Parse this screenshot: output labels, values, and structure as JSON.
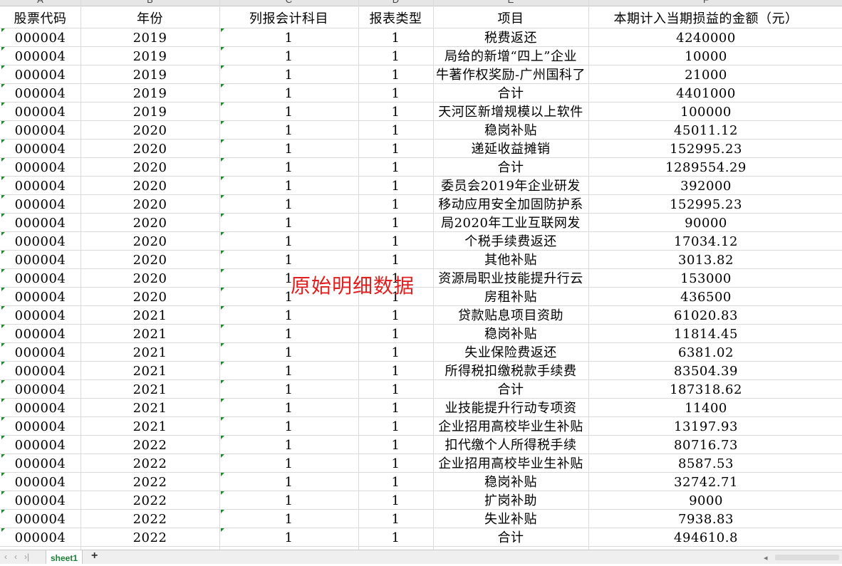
{
  "column_letters": [
    "A",
    "B",
    "C",
    "D",
    "E",
    "F"
  ],
  "headers": [
    "股票代码",
    "年份",
    "列报会计科目",
    "报表类型",
    "项目",
    "本期计入当期损益的金额（元）"
  ],
  "rows": [
    [
      "000004",
      "2019",
      "1",
      "1",
      "税费返还",
      "4240000"
    ],
    [
      "000004",
      "2019",
      "1",
      "1",
      "局给的新增“四上”企业",
      "10000"
    ],
    [
      "000004",
      "2019",
      "1",
      "1",
      "牛著作权奖励-广州国科了",
      "21000"
    ],
    [
      "000004",
      "2019",
      "1",
      "1",
      "合计",
      "4401000"
    ],
    [
      "000004",
      "2019",
      "1",
      "1",
      "天河区新增规模以上软件",
      "100000"
    ],
    [
      "000004",
      "2020",
      "1",
      "1",
      "稳岗补贴",
      "45011.12"
    ],
    [
      "000004",
      "2020",
      "1",
      "1",
      "递延收益摊销",
      "152995.23"
    ],
    [
      "000004",
      "2020",
      "1",
      "1",
      "合计",
      "1289554.29"
    ],
    [
      "000004",
      "2020",
      "1",
      "1",
      "委员会2019年企业研发",
      "392000"
    ],
    [
      "000004",
      "2020",
      "1",
      "1",
      "移动应用安全加固防护系",
      "152995.23"
    ],
    [
      "000004",
      "2020",
      "1",
      "1",
      "局2020年工业互联网发",
      "90000"
    ],
    [
      "000004",
      "2020",
      "1",
      "1",
      "个税手续费返还",
      "17034.12"
    ],
    [
      "000004",
      "2020",
      "1",
      "1",
      "其他补贴",
      "3013.82"
    ],
    [
      "000004",
      "2020",
      "1",
      "1",
      "资源局职业技能提升行云",
      "153000"
    ],
    [
      "000004",
      "2020",
      "1",
      "1",
      "房租补贴",
      "436500"
    ],
    [
      "000004",
      "2021",
      "1",
      "1",
      "贷款贴息项目资助",
      "61020.83"
    ],
    [
      "000004",
      "2021",
      "1",
      "1",
      "稳岗补贴",
      "11814.45"
    ],
    [
      "000004",
      "2021",
      "1",
      "1",
      "失业保险费返还",
      "6381.02"
    ],
    [
      "000004",
      "2021",
      "1",
      "1",
      "所得税扣缴税款手续费",
      "83504.39"
    ],
    [
      "000004",
      "2021",
      "1",
      "1",
      "合计",
      "187318.62"
    ],
    [
      "000004",
      "2021",
      "1",
      "1",
      "业技能提升行动专项资",
      "11400"
    ],
    [
      "000004",
      "2021",
      "1",
      "1",
      "企业招用高校毕业生补贴",
      "13197.93"
    ],
    [
      "000004",
      "2022",
      "1",
      "1",
      "扣代缴个人所得税手续",
      "80716.73"
    ],
    [
      "000004",
      "2022",
      "1",
      "1",
      "企业招用高校毕业生补贴",
      "8587.53"
    ],
    [
      "000004",
      "2022",
      "1",
      "1",
      "稳岗补贴",
      "32742.71"
    ],
    [
      "000004",
      "2022",
      "1",
      "1",
      "扩岗补助",
      "9000"
    ],
    [
      "000004",
      "2022",
      "1",
      "1",
      "失业补贴",
      "7938.83"
    ],
    [
      "000004",
      "2022",
      "1",
      "1",
      "合计",
      "494610.8"
    ]
  ],
  "overlay_label": "原始明细数据",
  "tabs": {
    "nav_prev_first": "‹",
    "nav_prev": "‹",
    "nav_next": "›",
    "nav_last": "›|",
    "sheet_name": "sheet1",
    "add": "+"
  },
  "colors": {
    "grid": "#dadada",
    "green_marker": "#1a8a2e",
    "overlay": "#e02020",
    "tab_active": "#1a7f37"
  }
}
